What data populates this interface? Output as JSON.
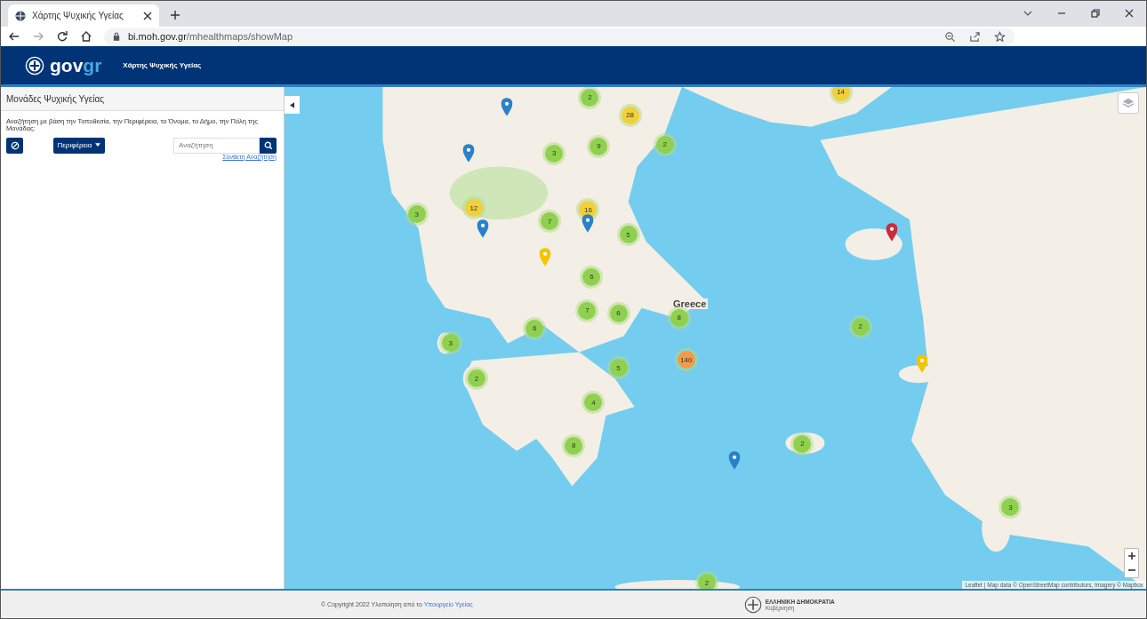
{
  "browser": {
    "tab_title": "Χάρτης Ψυχικής Υγείας",
    "url_host": "bi.moh.gov.gr",
    "url_path": "/mhealthmaps/showMap"
  },
  "header": {
    "logo": [
      "gov",
      "gr"
    ],
    "title": "Χάρτης Ψυχικής Υγείας"
  },
  "sidebar": {
    "title": "Μονάδες Ψυχικής Υγείας",
    "description": "Αναζήτηση με βάση την Τοποθεσία, την Περιφέρεια, το Όνομα, το Δήμο, την Πόλη της Μονάδας:",
    "dropdown": "Περιφέρεια",
    "search": {
      "placeholder": "Αναζήτηση"
    },
    "advanced_link": "Σύνθετη Αναζήτηση"
  },
  "map": {
    "clusters": [
      {
        "count": "2",
        "color": "#8fd14f"
      },
      {
        "count": "28",
        "color": "#f1d03a"
      },
      {
        "count": "3",
        "color": "#8fd14f"
      },
      {
        "count": "9",
        "color": "#8fd14f"
      },
      {
        "count": "2",
        "color": "#8fd14f"
      },
      {
        "count": "12",
        "color": "#f1d03a"
      },
      {
        "count": "3",
        "color": "#8fd14f"
      },
      {
        "count": "7",
        "color": "#8fd14f"
      },
      {
        "count": "16",
        "color": "#f1d03a"
      },
      {
        "count": "5",
        "color": "#8fd14f"
      },
      {
        "count": "6",
        "color": "#8fd14f"
      },
      {
        "count": "7",
        "color": "#8fd14f"
      },
      {
        "count": "6",
        "color": "#8fd14f"
      },
      {
        "count": "8",
        "color": "#8fd14f"
      },
      {
        "count": "6",
        "color": "#8fd14f"
      },
      {
        "count": "3",
        "color": "#8fd14f"
      },
      {
        "count": "2",
        "color": "#8fd14f"
      },
      {
        "count": "5",
        "color": "#8fd14f"
      },
      {
        "count": "4",
        "color": "#8fd14f"
      },
      {
        "count": "8",
        "color": "#8fd14f"
      },
      {
        "count": "140",
        "color": "#f39a4a"
      },
      {
        "count": "2",
        "color": "#8fd14f"
      },
      {
        "count": "14",
        "color": "#f1d03a"
      },
      {
        "count": "2",
        "color": "#8fd14f"
      },
      {
        "count": "2",
        "color": "#8fd14f"
      },
      {
        "count": "3",
        "color": "#8fd14f"
      }
    ],
    "markers": [
      {
        "color": "#2a81cb"
      },
      {
        "color": "#2a81cb"
      },
      {
        "color": "#2a81cb"
      },
      {
        "color": "#2a81cb"
      },
      {
        "color": "#2a81cb"
      },
      {
        "color": "#f4c400"
      },
      {
        "color": "#f4c400"
      },
      {
        "color": "#cb2b3e"
      }
    ],
    "labels": [
      "Greece"
    ],
    "attribution": "Leaflet | Map data © OpenStreetMap contributors, Imagery © Mapbox"
  },
  "footer": {
    "copyright": "© Copyright 2022 Υλοποίηση από το",
    "link": "Υπουργείο Υγείας",
    "emblem_title": "ΕΛΛΗΝΙΚΗ ΔΗΜΟΚΡΑΤΙΑ",
    "emblem_subtitle": "Κυβέρνηση"
  }
}
